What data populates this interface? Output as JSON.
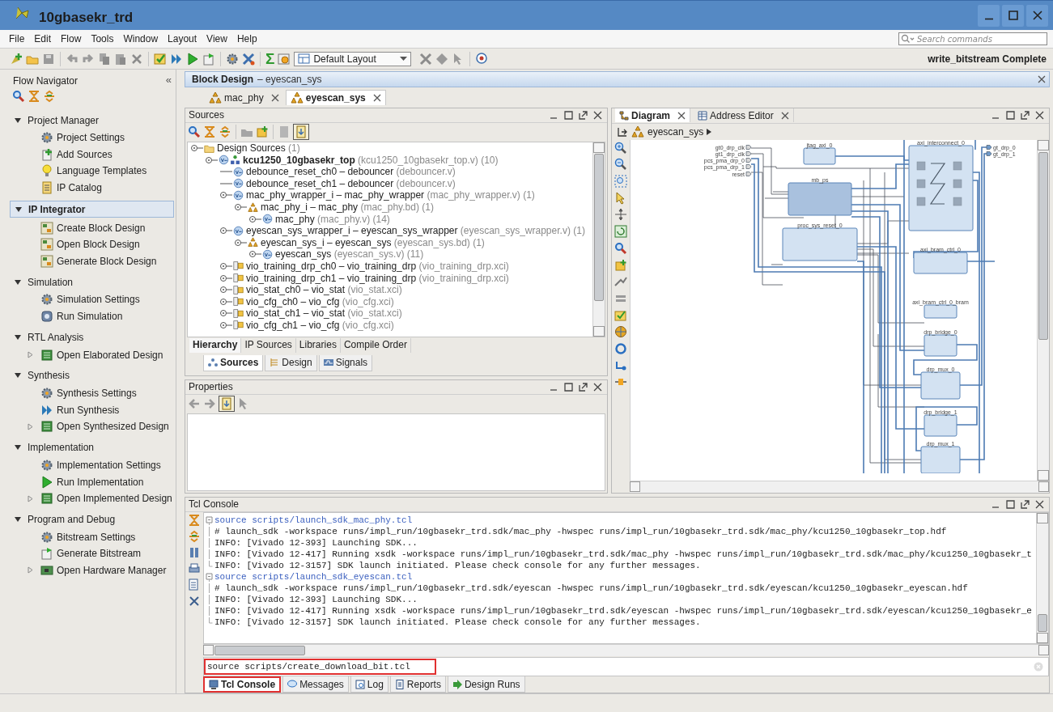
{
  "window": {
    "title": "10gbasekr_trd"
  },
  "menu": [
    "File",
    "Edit",
    "Flow",
    "Tools",
    "Window",
    "Layout",
    "View",
    "Help"
  ],
  "search": {
    "placeholder": "Search commands"
  },
  "toolbar": {
    "sigma": "Σ",
    "layout": "Default Layout",
    "status": "write_bitstream Complete"
  },
  "flow_navigator": {
    "title": "Flow Navigator",
    "collapse": "«",
    "sections": [
      {
        "title": "Project Manager",
        "selected": false,
        "items": [
          {
            "label": "Project Settings",
            "expandable": false
          },
          {
            "label": "Add Sources",
            "expandable": false
          },
          {
            "label": "Language Templates",
            "expandable": false
          },
          {
            "label": "IP Catalog",
            "expandable": false
          }
        ]
      },
      {
        "title": "IP Integrator",
        "selected": true,
        "items": [
          {
            "label": "Create Block Design",
            "expandable": false
          },
          {
            "label": "Open Block Design",
            "expandable": false
          },
          {
            "label": "Generate Block Design",
            "expandable": false
          }
        ]
      },
      {
        "title": "Simulation",
        "selected": false,
        "items": [
          {
            "label": "Simulation Settings",
            "expandable": false
          },
          {
            "label": "Run Simulation",
            "expandable": false
          }
        ]
      },
      {
        "title": "RTL Analysis",
        "selected": false,
        "items": [
          {
            "label": "Open Elaborated Design",
            "expandable": true
          }
        ]
      },
      {
        "title": "Synthesis",
        "selected": false,
        "items": [
          {
            "label": "Synthesis Settings",
            "expandable": false
          },
          {
            "label": "Run Synthesis",
            "expandable": false
          },
          {
            "label": "Open Synthesized Design",
            "expandable": true
          }
        ]
      },
      {
        "title": "Implementation",
        "selected": false,
        "items": [
          {
            "label": "Implementation Settings",
            "expandable": false
          },
          {
            "label": "Run Implementation",
            "expandable": false
          },
          {
            "label": "Open Implemented Design",
            "expandable": true
          }
        ]
      },
      {
        "title": "Program and Debug",
        "selected": false,
        "items": [
          {
            "label": "Bitstream Settings",
            "expandable": false
          },
          {
            "label": "Generate Bitstream",
            "expandable": false
          },
          {
            "label": "Open Hardware Manager",
            "expandable": true
          }
        ]
      }
    ]
  },
  "block_design": {
    "title": "Block Design",
    "subtitle": "– eyescan_sys",
    "tabs": [
      {
        "label": "mac_phy",
        "selected": false
      },
      {
        "label": "eyescan_sys",
        "selected": true
      }
    ]
  },
  "sources": {
    "title": "Sources",
    "tree": [
      {
        "kind": "folder",
        "name": "Design Sources",
        "detail": "(1)",
        "children": [
          {
            "kind": "top",
            "name": "kcu1250_10gbasekr_top",
            "detail": "(kcu1250_10gbasekr_top.v) (10)",
            "children": [
              {
                "kind": "verilog",
                "name": "debounce_reset_ch0 – debouncer",
                "detail": "(debouncer.v)"
              },
              {
                "kind": "verilog",
                "name": "debounce_reset_ch1 – debouncer",
                "detail": "(debouncer.v)"
              },
              {
                "kind": "verilog",
                "name": "mac_phy_wrapper_i – mac_phy_wrapper",
                "detail": "(mac_phy_wrapper.v) (1)",
                "children": [
                  {
                    "kind": "bd",
                    "name": "mac_phy_i – mac_phy",
                    "detail": "(mac_phy.bd) (1)",
                    "children": [
                      {
                        "kind": "verilog",
                        "name": "mac_phy",
                        "detail": "(mac_phy.v) (14)",
                        "collapsed": true
                      }
                    ]
                  }
                ]
              },
              {
                "kind": "verilog",
                "name": "eyescan_sys_wrapper_i – eyescan_sys_wrapper",
                "detail": "(eyescan_sys_wrapper.v) (1)",
                "children": [
                  {
                    "kind": "bd",
                    "name": "eyescan_sys_i – eyescan_sys",
                    "detail": "(eyescan_sys.bd) (1)",
                    "children": [
                      {
                        "kind": "verilog",
                        "name": "eyescan_sys",
                        "detail": "(eyescan_sys.v) (11)",
                        "collapsed": true
                      }
                    ]
                  }
                ]
              },
              {
                "kind": "xci",
                "name": "vio_training_drp_ch0 – vio_training_drp",
                "detail": "(vio_training_drp.xci)",
                "collapsed": true
              },
              {
                "kind": "xci",
                "name": "vio_training_drp_ch1 – vio_training_drp",
                "detail": "(vio_training_drp.xci)",
                "collapsed": true
              },
              {
                "kind": "xci",
                "name": "vio_stat_ch0 – vio_stat",
                "detail": "(vio_stat.xci)",
                "collapsed": true
              },
              {
                "kind": "xci",
                "name": "vio_cfg_ch0 – vio_cfg",
                "detail": "(vio_cfg.xci)",
                "collapsed": true
              },
              {
                "kind": "xci",
                "name": "vio_stat_ch1 – vio_stat",
                "detail": "(vio_stat.xci)",
                "collapsed": true
              },
              {
                "kind": "xci",
                "name": "vio_cfg_ch1 – vio_cfg",
                "detail": "(vio_cfg.xci)",
                "collapsed": true
              }
            ]
          }
        ]
      }
    ],
    "view_tabs": [
      {
        "label": "Hierarchy",
        "selected": true
      },
      {
        "label": "IP Sources",
        "selected": false
      },
      {
        "label": "Libraries",
        "selected": false
      },
      {
        "label": "Compile Order",
        "selected": false
      }
    ],
    "bottom_tabs": [
      {
        "label": "Sources",
        "selected": true
      },
      {
        "label": "Design",
        "selected": false
      },
      {
        "label": "Signals",
        "selected": false
      }
    ]
  },
  "properties": {
    "title": "Properties"
  },
  "diagram": {
    "tabs": [
      {
        "label": "Diagram",
        "selected": true
      },
      {
        "label": "Address Editor",
        "selected": false
      }
    ],
    "breadcrumb": "eyescan_sys",
    "input_ports": [
      "gt0_drp_clk",
      "gt1_drp_clk",
      "pcs_pma_drp_0",
      "pcs_pma_drp_1",
      "reset"
    ],
    "output_ports": [
      "gt_drp_0",
      "gt_drp_1"
    ],
    "blocks": [
      {
        "label": "jtag_axi_0"
      },
      {
        "label": "mb_ps"
      },
      {
        "label": "proc_sys_reset_0"
      },
      {
        "label": "axi_interconnect_0"
      },
      {
        "label": "axi_bram_ctrl_0"
      },
      {
        "label": "axi_bram_ctrl_0_bram"
      },
      {
        "label": "drp_bridge_0"
      },
      {
        "label": "drp_mux_0"
      },
      {
        "label": "drp_bridge_1"
      },
      {
        "label": "drp_mux_1"
      }
    ]
  },
  "tcl_console": {
    "title": "Tcl Console",
    "lines": [
      {
        "kind": "command",
        "text": "source scripts/launch_sdk_mac_phy.tcl"
      },
      {
        "kind": "output",
        "text": "# launch_sdk -workspace runs/impl_run/10gbasekr_trd.sdk/mac_phy -hwspec runs/impl_run/10gbasekr_trd.sdk/mac_phy/kcu1250_10gbasekr_top.hdf"
      },
      {
        "kind": "output",
        "text": "INFO: [Vivado 12-393] Launching SDK..."
      },
      {
        "kind": "output",
        "text": "INFO: [Vivado 12-417] Running xsdk -workspace runs/impl_run/10gbasekr_trd.sdk/mac_phy -hwspec runs/impl_run/10gbasekr_trd.sdk/mac_phy/kcu1250_10gbasekr_t"
      },
      {
        "kind": "end",
        "text": "INFO: [Vivado 12-3157] SDK launch initiated. Please check console for any further messages."
      },
      {
        "kind": "command",
        "text": "source scripts/launch_sdk_eyescan.tcl"
      },
      {
        "kind": "output",
        "text": "# launch_sdk -workspace runs/impl_run/10gbasekr_trd.sdk/eyescan -hwspec runs/impl_run/10gbasekr_trd.sdk/eyescan/kcu1250_10gbasekr_eyescan.hdf"
      },
      {
        "kind": "output",
        "text": "INFO: [Vivado 12-393] Launching SDK..."
      },
      {
        "kind": "output",
        "text": "INFO: [Vivado 12-417] Running xsdk -workspace runs/impl_run/10gbasekr_trd.sdk/eyescan -hwspec runs/impl_run/10gbasekr_trd.sdk/eyescan/kcu1250_10gbasekr_e"
      },
      {
        "kind": "end",
        "text": "INFO: [Vivado 12-3157] SDK launch initiated. Please check console for any further messages."
      }
    ],
    "input": {
      "value": "source scripts/create_download_bit.tcl",
      "highlighted": true
    },
    "tabs": [
      {
        "label": "Tcl Console",
        "selected": true,
        "highlighted": true
      },
      {
        "label": "Messages",
        "selected": false,
        "highlighted": false
      },
      {
        "label": "Log",
        "selected": false,
        "highlighted": false
      },
      {
        "label": "Reports",
        "selected": false,
        "highlighted": false
      },
      {
        "label": "Design Runs",
        "selected": false,
        "highlighted": false
      }
    ]
  }
}
